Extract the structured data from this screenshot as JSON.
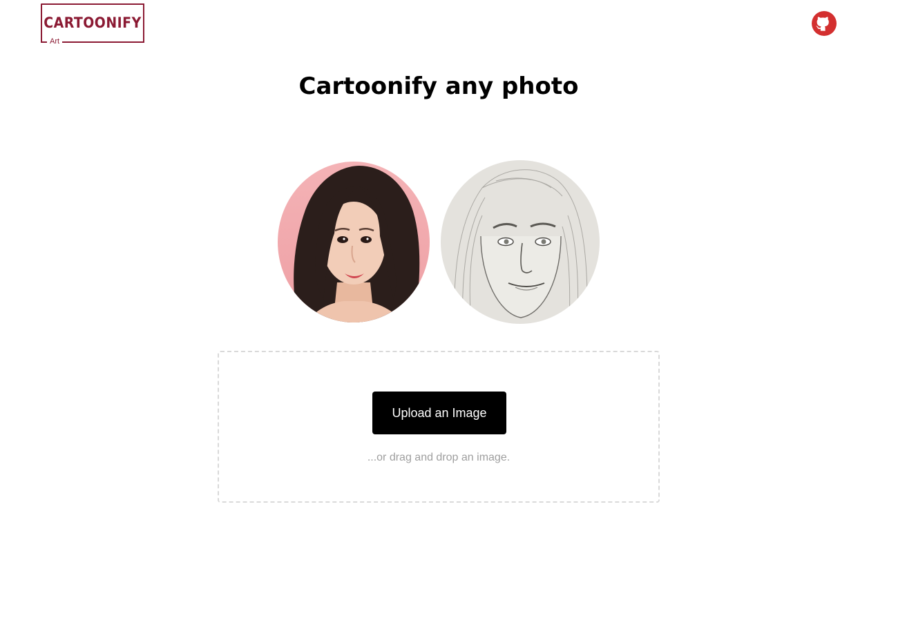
{
  "header": {
    "logo_text": "CARTOONIFY",
    "logo_subtext": "Art",
    "github_icon": "github-icon"
  },
  "main": {
    "title": "Cartoonify any photo",
    "samples": [
      {
        "name": "original-photo"
      },
      {
        "name": "pencil-sketch-result"
      }
    ],
    "upload": {
      "button_label": "Upload an Image",
      "hint": "...or drag and drop an image."
    }
  },
  "colors": {
    "brand": "#8b1a33",
    "github": "#d32f2f",
    "button_bg": "#000000",
    "button_text": "#ffffff",
    "hint_text": "#9e9e9e",
    "dropzone_border": "#d9d9d9"
  }
}
